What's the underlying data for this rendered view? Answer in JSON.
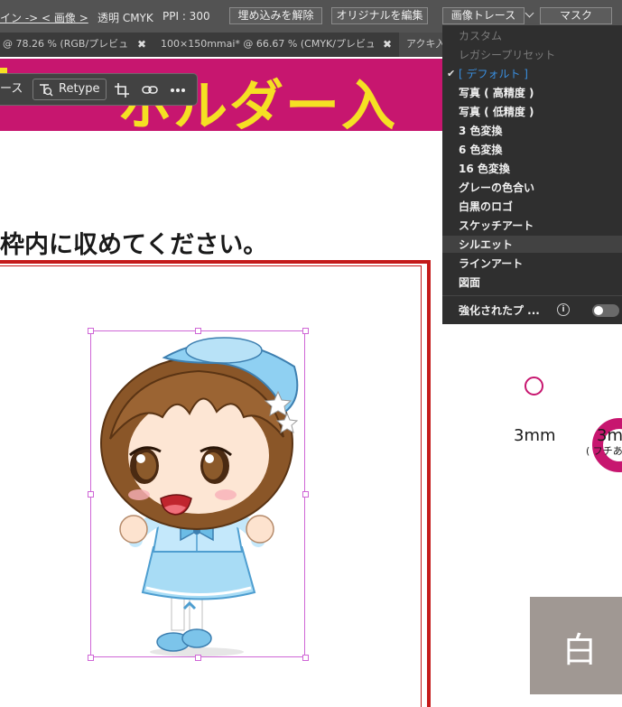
{
  "control_bar": {
    "breadcrumb": "イン -> < 画像 >",
    "info": "透明 CMYK",
    "ppi": "PPI : 300",
    "buttons": {
      "unembed": "埋め込みを解除",
      "edit_original": "オリジナルを編集",
      "image_trace": "画像トレース",
      "mask": "マスク"
    }
  },
  "tabs": [
    {
      "label": "@ 78.26 % (RGB/プレビュー)"
    },
    {
      "label": "100×150mmai* @ 66.67 % (CMYK/プレビュー)"
    },
    {
      "label": "アクキ入"
    }
  ],
  "task_bar": {
    "trace_label": "ース",
    "retype_label": "Retype"
  },
  "canvas": {
    "banner_text": "ホルダー入",
    "instruction": "枠内に収めてください。",
    "ring_label_1": "3mm",
    "ring_label_2": "3m",
    "ring_sublabel": "( フチあ",
    "block_text": "白"
  },
  "trace_menu": {
    "items": [
      {
        "label": "カスタム"
      },
      {
        "label": "レガシープリセット"
      },
      {
        "label": "[ デフォルト ]"
      },
      {
        "label": "写真 ( 高精度 )"
      },
      {
        "label": "写真 ( 低精度 )"
      },
      {
        "label": "3 色変換"
      },
      {
        "label": "6 色変換"
      },
      {
        "label": "16 色変換"
      },
      {
        "label": "グレーの色合い"
      },
      {
        "label": "白黒のロゴ"
      },
      {
        "label": "スケッチアート"
      },
      {
        "label": "シルエット"
      },
      {
        "label": "ラインアート"
      },
      {
        "label": "図面"
      }
    ],
    "enhanced_label": "強化されたプ ..."
  },
  "colors": {
    "brand_magenta": "#c7166f",
    "banner_yellow": "#f5e023",
    "frame_red": "#c41a1a",
    "selection_magenta": "#cf66d6",
    "menu_selected_blue": "#3a8fe0"
  },
  "icons": [
    "chevron-down-icon",
    "text-select-icon",
    "crop-icon",
    "link-icon",
    "more-icon",
    "check-icon",
    "info-icon",
    "close-icon"
  ]
}
